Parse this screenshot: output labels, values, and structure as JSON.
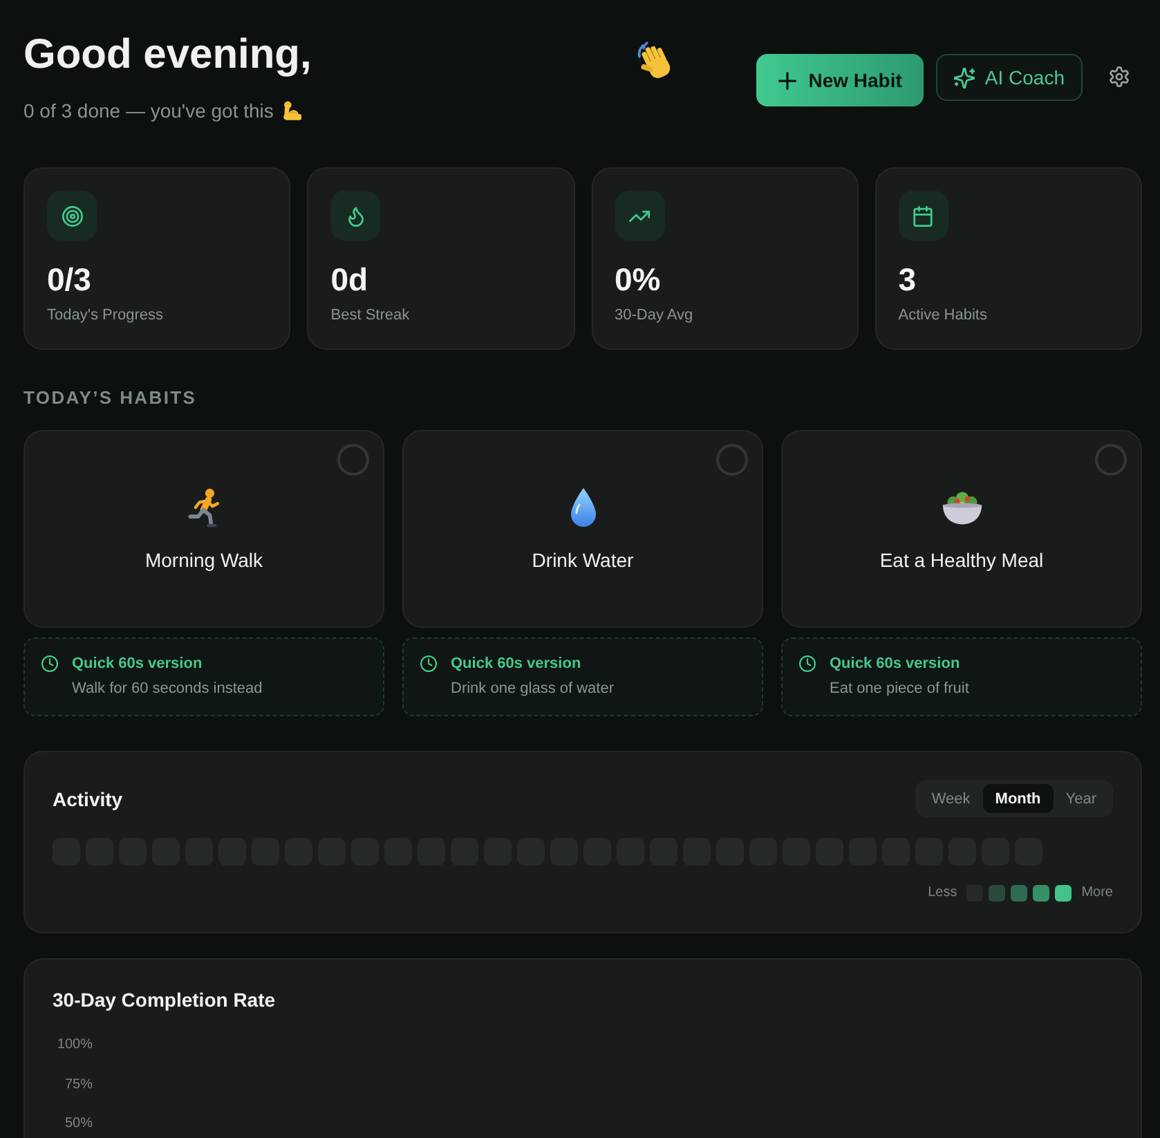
{
  "header": {
    "title": "Good evening,",
    "subtitle": "0 of 3 done — you've got this",
    "buttons": [
      {
        "label": "New Habit",
        "kind": "primary"
      },
      {
        "label": "AI Coach",
        "kind": "outline"
      }
    ]
  },
  "stats": [
    {
      "value": "0/3",
      "label": "Today's Progress"
    },
    {
      "value": "0d",
      "label": "Best Streak"
    },
    {
      "value": "0%",
      "label": "30-Day Avg"
    },
    {
      "value": "3",
      "label": "Active Habits"
    }
  ],
  "habits_section": {
    "heading": "TODAY’S HABITS"
  },
  "habits": [
    {
      "name": "Morning Walk",
      "checked": false,
      "quick": {
        "title": "Quick 60s version",
        "text": "Walk for 60 seconds instead"
      }
    },
    {
      "name": "Drink Water",
      "checked": false,
      "quick": {
        "title": "Quick 60s version",
        "text": "Drink one glass of water"
      }
    },
    {
      "name": "Eat a Healthy Meal",
      "checked": false,
      "quick": {
        "title": "Quick 60s version",
        "text": "Eat one piece of fruit"
      }
    }
  ],
  "activity": {
    "title": "Activity",
    "tabs": [
      {
        "label": "Week",
        "selected": false
      },
      {
        "label": "Month",
        "selected": true
      },
      {
        "label": "Year",
        "selected": false
      }
    ],
    "cells": [
      {
        "color": "#252a28"
      },
      {
        "color": "#252a28"
      },
      {
        "color": "#252a28"
      },
      {
        "color": "#252a28"
      },
      {
        "color": "#252a28"
      },
      {
        "color": "#252a28"
      },
      {
        "color": "#252a28"
      },
      {
        "color": "#252a28"
      },
      {
        "color": "#252a28"
      },
      {
        "color": "#252a28"
      },
      {
        "color": "#252a28"
      },
      {
        "color": "#252a28"
      },
      {
        "color": "#252a28"
      },
      {
        "color": "#252a28"
      },
      {
        "color": "#252a28"
      },
      {
        "color": "#252a28"
      },
      {
        "color": "#252a28"
      },
      {
        "color": "#252a28"
      },
      {
        "color": "#252a28"
      },
      {
        "color": "#252a28"
      },
      {
        "color": "#252a28"
      },
      {
        "color": "#252a28"
      },
      {
        "color": "#252a28"
      },
      {
        "color": "#252a28"
      },
      {
        "color": "#252a28"
      },
      {
        "color": "#252a28"
      },
      {
        "color": "#252a28"
      },
      {
        "color": "#252a28"
      },
      {
        "color": "#252a28"
      },
      {
        "color": "#252a28"
      }
    ],
    "legend": {
      "less": "Less",
      "more": "More",
      "swatches": [
        {
          "color": "#252a28"
        },
        {
          "color": "#284a3b"
        },
        {
          "color": "#2e6b51"
        },
        {
          "color": "#359068"
        },
        {
          "color": "#42c38b"
        }
      ]
    }
  },
  "completion": {
    "title": "30-Day Completion Rate",
    "y_labels": [
      "100%",
      "75%",
      "50%"
    ]
  }
}
